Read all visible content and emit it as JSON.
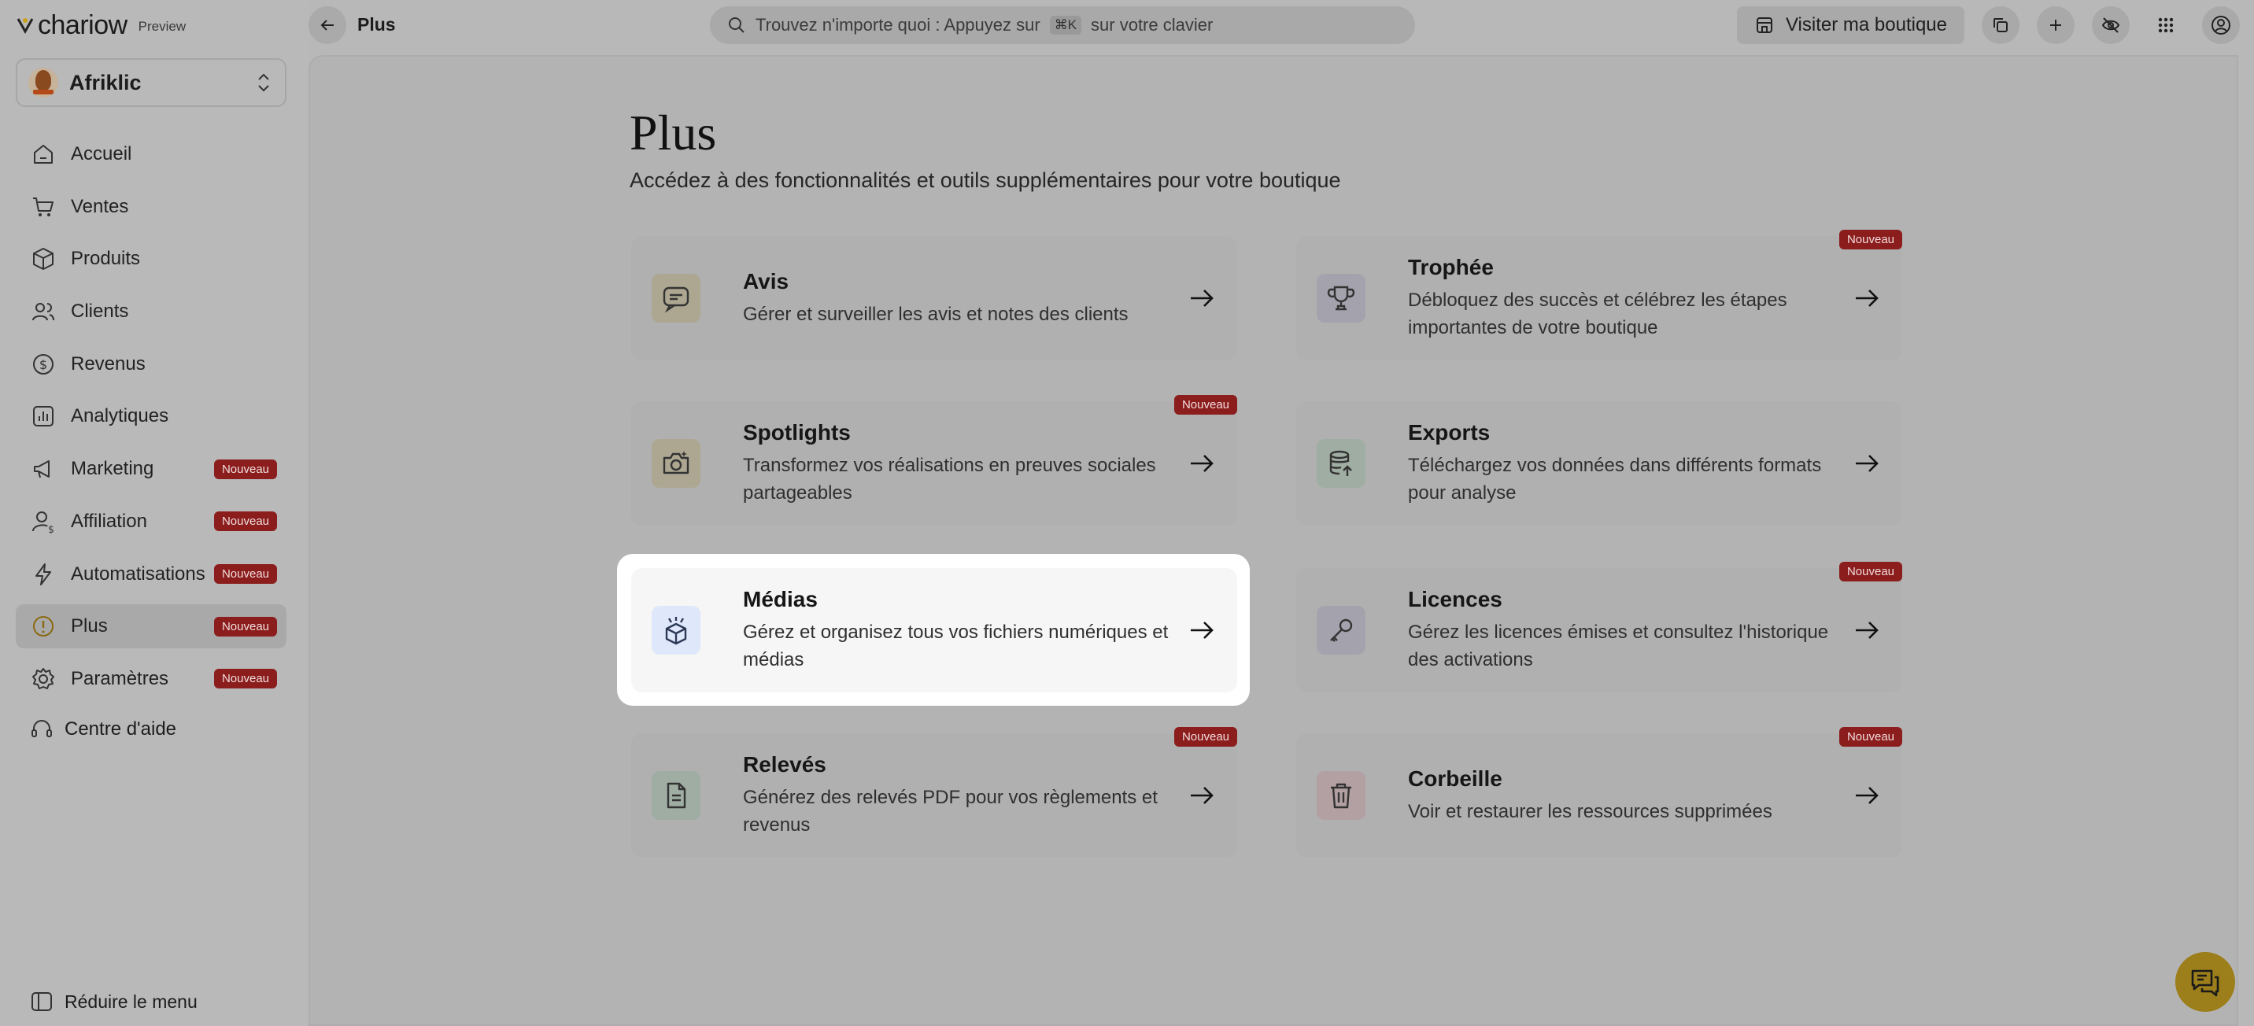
{
  "app": {
    "logo_text": "chariow",
    "preview_label": "Preview"
  },
  "store": {
    "name": "Afriklic"
  },
  "sidebar": {
    "items": [
      {
        "label": "Accueil",
        "icon": "home-icon",
        "badge": ""
      },
      {
        "label": "Ventes",
        "icon": "cart-icon",
        "badge": ""
      },
      {
        "label": "Produits",
        "icon": "box-icon",
        "badge": ""
      },
      {
        "label": "Clients",
        "icon": "users-icon",
        "badge": ""
      },
      {
        "label": "Revenus",
        "icon": "dollar-icon",
        "badge": ""
      },
      {
        "label": "Analytiques",
        "icon": "chart-icon",
        "badge": ""
      },
      {
        "label": "Marketing",
        "icon": "megaphone-icon",
        "badge": "Nouveau"
      },
      {
        "label": "Affiliation",
        "icon": "affiliate-icon",
        "badge": "Nouveau"
      },
      {
        "label": "Automatisations",
        "icon": "bolt-icon",
        "badge": "Nouveau"
      },
      {
        "label": "Plus",
        "icon": "info-icon",
        "badge": "Nouveau",
        "active": true
      },
      {
        "label": "Paramètres",
        "icon": "gear-icon",
        "badge": "Nouveau"
      }
    ],
    "help_label": "Centre d'aide",
    "collapse_label": "Réduire le menu"
  },
  "topbar": {
    "crumb": "Plus",
    "search_placeholder_before": "Trouvez n'importe quoi : Appuyez sur",
    "search_key": "⌘K",
    "search_placeholder_after": "sur votre clavier",
    "visit_label": "Visiter ma boutique"
  },
  "page": {
    "title": "Plus",
    "subtitle": "Accédez à des fonctionnalités et outils supplémentaires pour votre boutique"
  },
  "cards": [
    {
      "title": "Avis",
      "desc": "Gérer et surveiller les avis et notes des clients",
      "badge": "",
      "icon": "message-icon",
      "icon_bg": "#ada792"
    },
    {
      "title": "Trophée",
      "desc": "Débloquez des succès et célébrez les étapes importantes de votre boutique",
      "badge": "Nouveau",
      "icon": "trophy-icon",
      "icon_bg": "#a4a3ad"
    },
    {
      "title": "Spotlights",
      "desc": "Transformez vos réalisations en preuves sociales partageables",
      "badge": "Nouveau",
      "icon": "camera-icon",
      "icon_bg": "#ada792"
    },
    {
      "title": "Exports",
      "desc": "Téléchargez vos données dans différents formats pour analyse",
      "badge": "",
      "icon": "database-icon",
      "icon_bg": "#9fada3"
    },
    {
      "title": "Médias",
      "desc": "Gérez et organisez tous vos fichiers numériques et médias",
      "badge": "",
      "icon": "media-box-icon",
      "icon_bg": "#dfe8fb",
      "highlight": true
    },
    {
      "title": "Licences",
      "desc": "Gérez les licences émises et consultez l'historique des activations",
      "badge": "Nouveau",
      "icon": "key-icon",
      "icon_bg": "#a4a3ad"
    },
    {
      "title": "Relevés",
      "desc": "Générez des relevés PDF pour vos règlements et revenus",
      "badge": "Nouveau",
      "icon": "document-icon",
      "icon_bg": "#9fada3"
    },
    {
      "title": "Corbeille",
      "desc": "Voir et restaurer les ressources supprimées",
      "badge": "Nouveau",
      "icon": "trash-icon",
      "icon_bg": "#b2a0a3"
    }
  ],
  "colors": {
    "badge": "#8b1d1d",
    "chat_fab": "#9c7e1a",
    "highlight": "#ffffff"
  }
}
